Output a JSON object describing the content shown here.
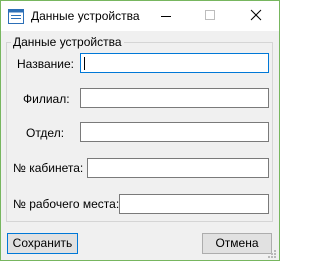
{
  "window": {
    "title": "Данные устройства",
    "icon": "form-icon"
  },
  "group": {
    "label": "Данные устройства"
  },
  "fields": [
    {
      "label": "Название:",
      "value": ""
    },
    {
      "label": "Филиал:",
      "value": ""
    },
    {
      "label": "Отдел:",
      "value": ""
    },
    {
      "label": "№ кабинета:",
      "value": ""
    },
    {
      "label": "№ рабочего места:",
      "value": ""
    }
  ],
  "buttons": {
    "save_label": "Сохранить",
    "cancel_label": "Отмена"
  },
  "colors": {
    "window_border": "#77b65f",
    "focus_border": "#0078d7",
    "client_bg": "#f0f0f0"
  }
}
